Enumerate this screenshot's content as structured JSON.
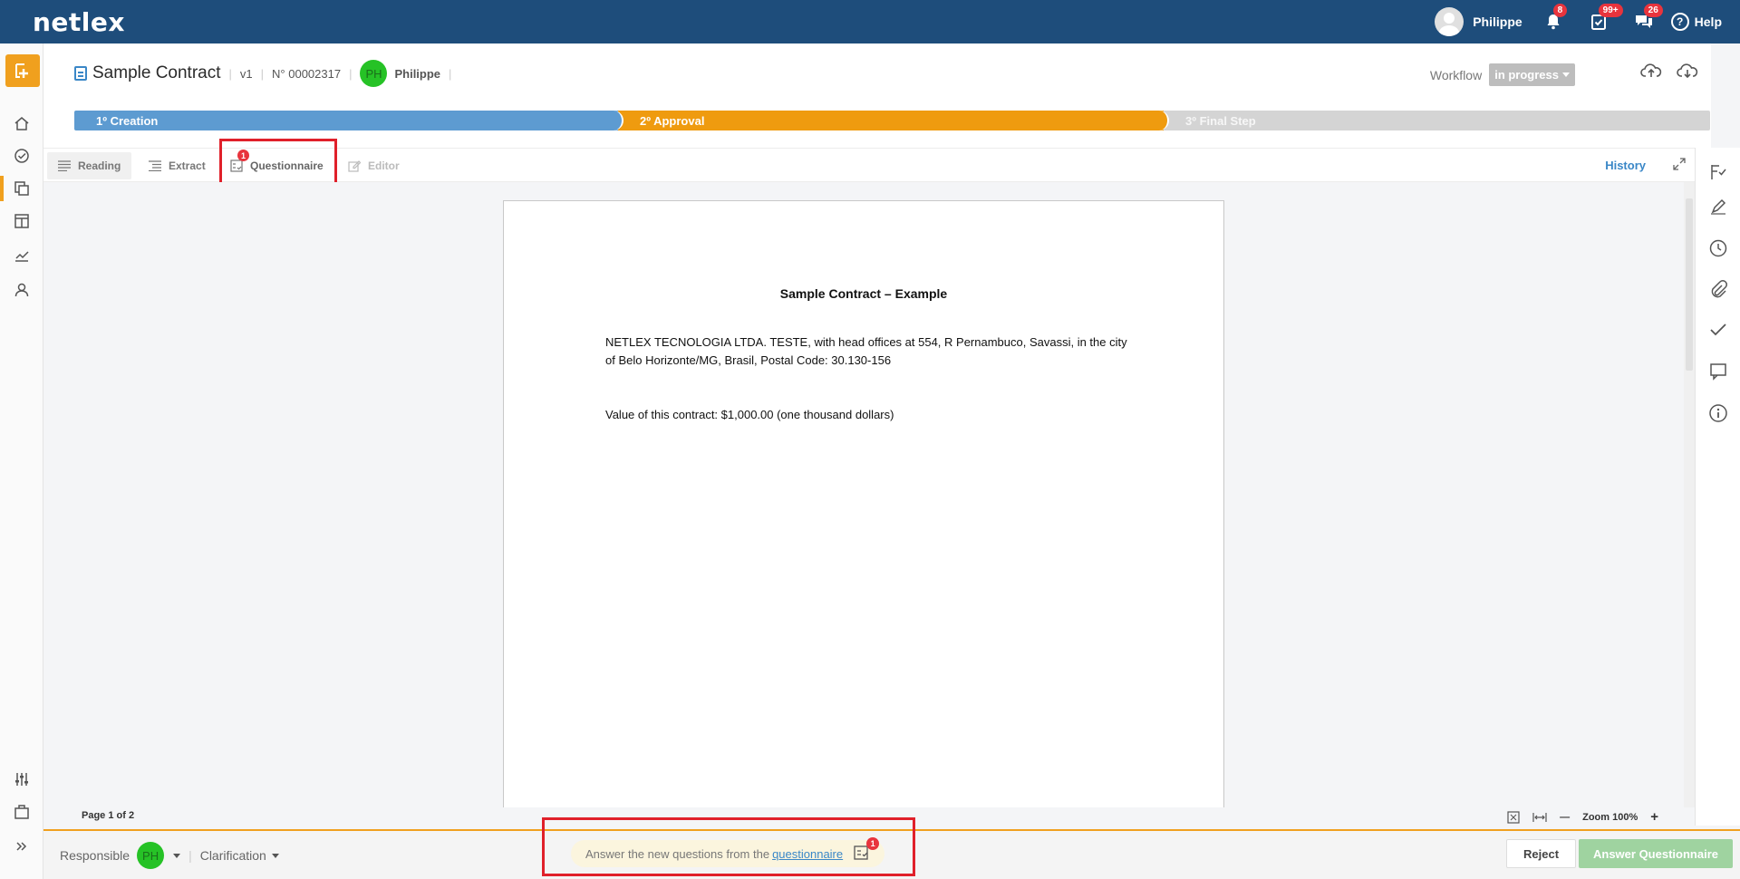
{
  "app": {
    "logo": "netlex"
  },
  "topbar": {
    "user_name": "Philippe",
    "notifications_badge": "8",
    "tasks_badge": "99+",
    "messages_badge": "26",
    "help_label": "Help",
    "help_symbol": "?"
  },
  "document": {
    "title": "Sample Contract",
    "version": "v1",
    "number": "N° 00002317",
    "owner_initials": "PH",
    "owner_name": "Philippe",
    "workflow_label": "Workflow",
    "workflow_status": "in progress"
  },
  "steps": [
    "1º Creation",
    "2º Approval",
    "3º Final Step"
  ],
  "tabs": {
    "reading": "Reading",
    "extract": "Extract",
    "questionnaire": "Questionnaire",
    "questionnaire_badge": "1",
    "editor": "Editor",
    "history": "History"
  },
  "page": {
    "title": "Sample Contract – Example",
    "paragraph1": "NETLEX TECNOLOGIA LTDA. TESTE, with head offices at 554, R Pernambuco, Savassi, in the city of Belo Horizonte/MG, Brasil, Postal Code: 30.130-156",
    "paragraph2": "Value of this contract: $1,000.00 (one thousand dollars)"
  },
  "status": {
    "page_count": "Page 1 of 2",
    "zoom": "Zoom 100%"
  },
  "bottom": {
    "responsible_label": "Responsible",
    "responsible_initials": "PH",
    "clarification_label": "Clarification",
    "notice_text": "Answer the new questions from the",
    "notice_link": "questionnaire",
    "notice_badge": "1",
    "reject_label": "Reject",
    "answer_label": "Answer Questionnaire"
  },
  "colors": {
    "topbar": "#1e4d7b",
    "accent_orange": "#f0a01e",
    "step_blue": "#5d9bd1",
    "step_orange": "#ef9b0f",
    "avatar_green": "#26c226",
    "highlight_red": "#e0202a",
    "answer_green": "#9fd3a0"
  }
}
